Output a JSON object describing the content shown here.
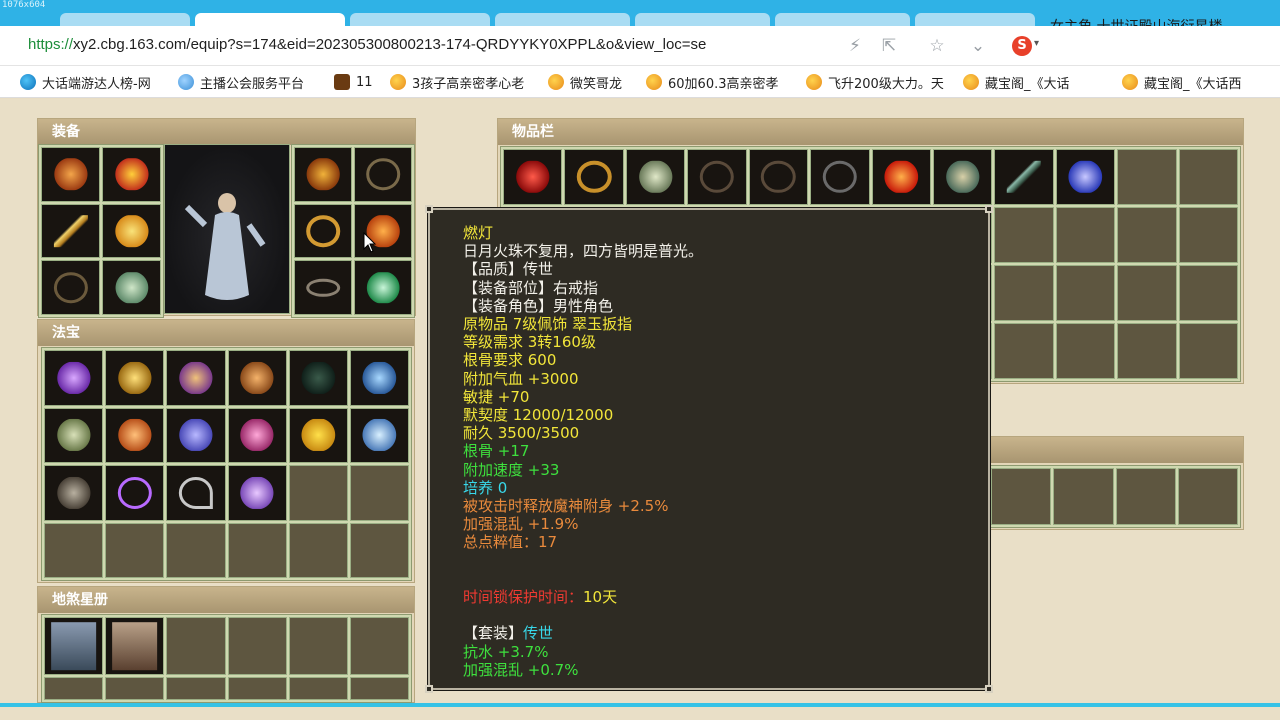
{
  "browser": {
    "dimension_label": "1076x604",
    "overlay_text": "女主角   十世证殿山海衍星楼",
    "url_scheme": "https://",
    "url_rest": "xy2.cbg.163.com/equip?s=174&eid=202305300800213-174-QRDYYKY0XPPL&o&view_loc=se",
    "bookmarks": [
      {
        "label": "大话端游达人榜-网",
        "icon": "edge"
      },
      {
        "label": "主播公会服务平台",
        "icon": "cloud"
      },
      {
        "label": "11",
        "icon": "game"
      },
      {
        "label": "3孩子高亲密孝心老",
        "icon": "bird"
      },
      {
        "label": "微笑哥龙",
        "icon": "bird"
      },
      {
        "label": "60加60.3高亲密孝",
        "icon": "bird"
      },
      {
        "label": "飞升200级大力。天",
        "icon": "bird"
      },
      {
        "label": "藏宝阁_《大话",
        "icon": "bird"
      },
      {
        "label": "藏宝阁_《大话西",
        "icon": "bird"
      }
    ]
  },
  "panels": {
    "equipment": "装备",
    "fabao": "法宝",
    "disha": "地煞星册",
    "inventory": "物品栏"
  },
  "tooltip": {
    "lines": [
      {
        "text": "燃灯",
        "color": "yellow"
      },
      {
        "text": "日月火珠不复用，四方皆明是普光。",
        "color": "white"
      },
      {
        "text": "【品质】传世",
        "color": "white"
      },
      {
        "text": "【装备部位】右戒指",
        "color": "white"
      },
      {
        "text": "【装备角色】男性角色",
        "color": "white"
      },
      {
        "text": "原物品 7级佩饰 翠玉扳指",
        "color": "yellow"
      },
      {
        "text": "等级需求 3转160级",
        "color": "yellow"
      },
      {
        "text": "根骨要求 600",
        "color": "yellow"
      },
      {
        "text": "附加气血 +3000",
        "color": "yellow"
      },
      {
        "text": "敏捷 +70",
        "color": "yellow"
      },
      {
        "text": "默契度 12000/12000",
        "color": "yellow"
      },
      {
        "text": "耐久 3500/3500",
        "color": "yellow"
      },
      {
        "text": "根骨 +17",
        "color": "green"
      },
      {
        "text": "附加速度 +33",
        "color": "green"
      },
      {
        "text": "培养 0",
        "color": "cyan"
      },
      {
        "text": "被攻击时释放魔神附身 +2.5%",
        "color": "orange"
      },
      {
        "text": "加强混乱 +1.9%",
        "color": "orange"
      },
      {
        "text": "总点粹值：17",
        "color": "orange"
      }
    ],
    "lock_label": "时间锁保护时间：",
    "lock_value": "10天",
    "set_label": "【套装】",
    "set_value": "传世",
    "set_lines": [
      {
        "text": "抗水 +3.7%",
        "color": "green"
      },
      {
        "text": "加强混乱 +0.7%",
        "color": "green"
      }
    ]
  }
}
